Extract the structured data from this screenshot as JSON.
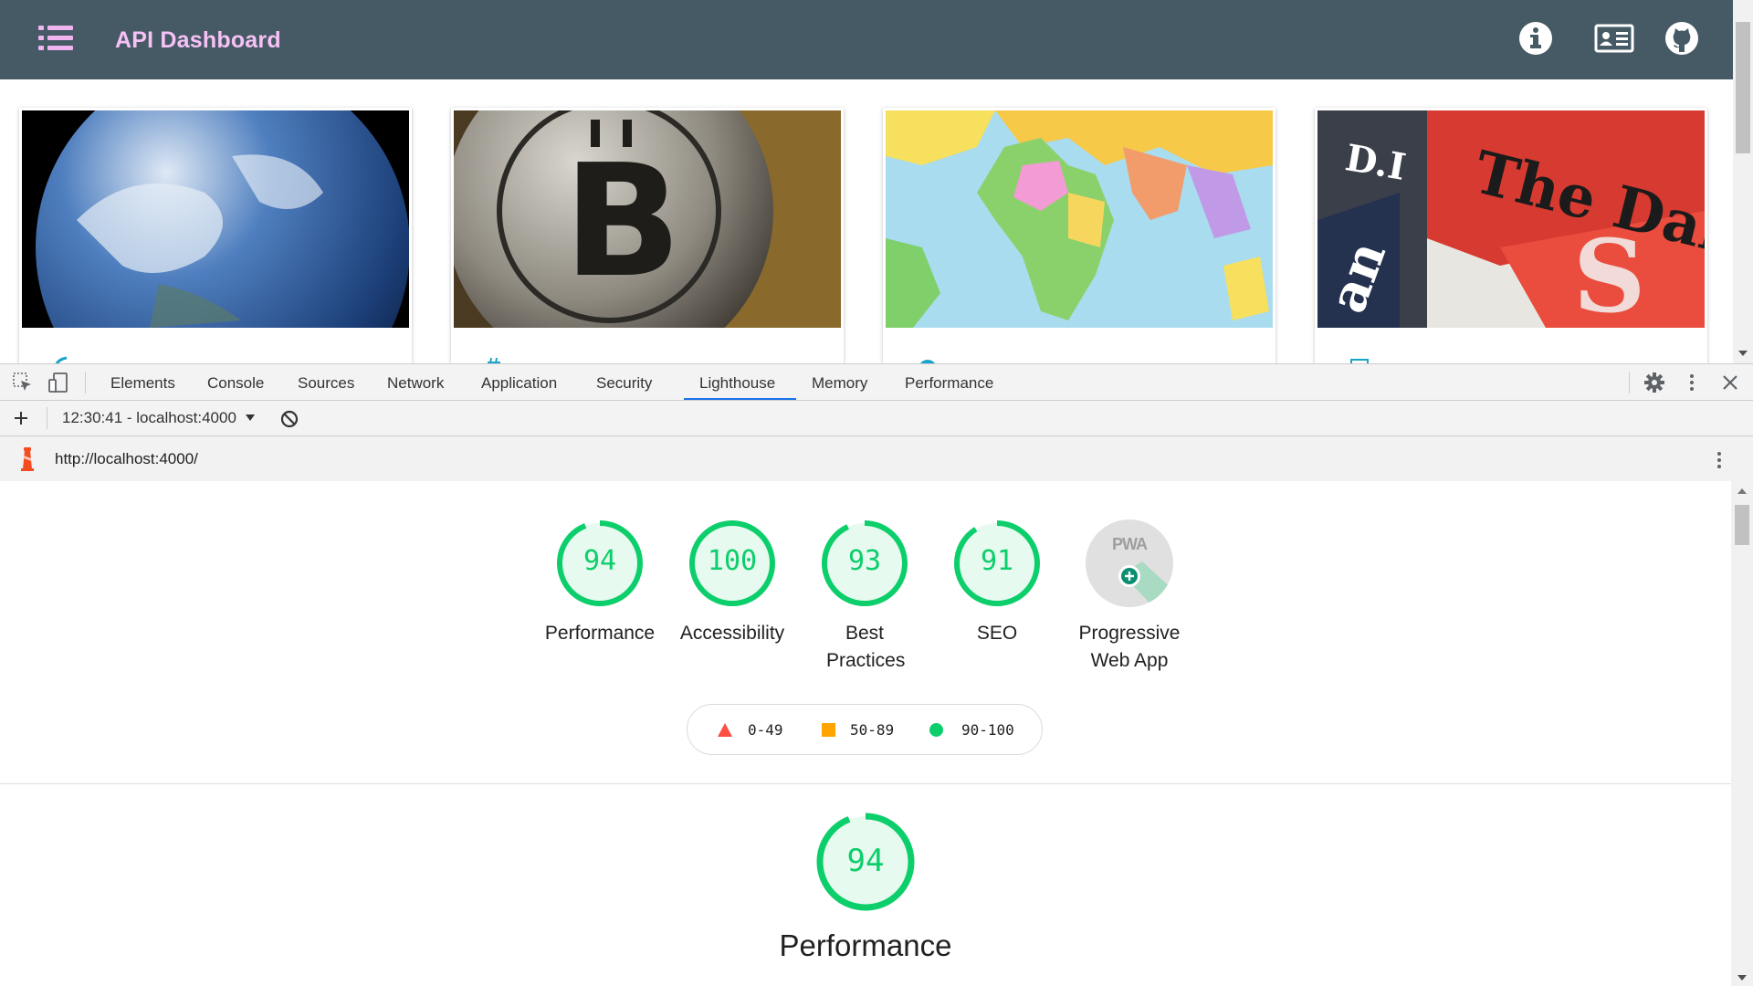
{
  "app": {
    "title": "API Dashboard",
    "header_bg": "#455a64",
    "accent": "#f0b4f0",
    "icons": [
      "menu-list-icon",
      "info-icon",
      "contact-card-icon",
      "github-icon"
    ]
  },
  "cards": [
    {
      "image": "earth-from-space",
      "icon": "rss-icon"
    },
    {
      "image": "bitcoin-coins",
      "icon": "hash-icon"
    },
    {
      "image": "world-political-map",
      "icon": "globe-icon"
    },
    {
      "image": "newspapers",
      "icon": "news-icon"
    }
  ],
  "devtools": {
    "tabs": [
      "Elements",
      "Console",
      "Sources",
      "Network",
      "Application",
      "Security",
      "Lighthouse",
      "Memory",
      "Performance"
    ],
    "active_tab": "Lighthouse",
    "report_select": "12:30:41 - localhost:4000",
    "url": "http://localhost:4000/",
    "icons": [
      "inspect-element-icon",
      "device-toolbar-icon",
      "settings-gear-icon",
      "more-vertical-icon",
      "close-icon",
      "add-icon",
      "clear-block-icon",
      "lighthouse-icon"
    ]
  },
  "lighthouse": {
    "color_pass": "#0cce6b",
    "gauges": [
      {
        "score": "94",
        "label": "Performance",
        "fraction": 0.94
      },
      {
        "score": "100",
        "label": "Accessibility",
        "fraction": 1.0
      },
      {
        "score": "93",
        "label": "Best Practices",
        "fraction": 0.93
      },
      {
        "score": "91",
        "label": "SEO",
        "fraction": 0.91
      }
    ],
    "pwa": {
      "badge": "PWA",
      "label": "Progressive Web App"
    },
    "legend": [
      {
        "range": "0-49",
        "color": "#ff4e42",
        "shape": "triangle"
      },
      {
        "range": "50-89",
        "color": "#ffa400",
        "shape": "square"
      },
      {
        "range": "90-100",
        "color": "#0cce6b",
        "shape": "circle"
      }
    ],
    "section": {
      "score": "94",
      "label": "Performance",
      "fraction": 0.94
    }
  }
}
